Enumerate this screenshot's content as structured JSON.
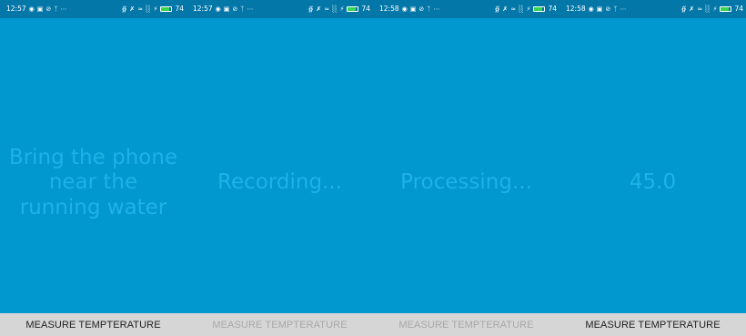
{
  "colors": {
    "status_bar": "#0277a8",
    "content_background": "#0197cf",
    "main_text": "#1fb2e6",
    "button_background": "#d6d6d6",
    "button_text_enabled": "#1e1e1e",
    "button_text_disabled": "#a8a8a8",
    "battery_fill": "#39d353"
  },
  "screens": [
    {
      "status": {
        "time": "12:57",
        "left_icons": [
          "chat-icon",
          "image-icon",
          "circle-check-icon",
          "usb-icon",
          "ellipsis-icon"
        ],
        "right_icons": [
          "bluetooth-icon",
          "vibrate-icon",
          "wifi-icon",
          "signal-icon",
          "charging-icon"
        ],
        "battery_level": "74"
      },
      "main_text": "Bring the phone near the running water",
      "button": {
        "label": "MEASURE TEMPTERATURE",
        "enabled": true
      }
    },
    {
      "status": {
        "time": "12:57",
        "left_icons": [
          "chat-icon",
          "image-icon",
          "circle-check-icon",
          "usb-icon",
          "ellipsis-icon"
        ],
        "right_icons": [
          "bluetooth-icon",
          "vibrate-icon",
          "wifi-icon",
          "signal-icon",
          "charging-icon"
        ],
        "battery_level": "74"
      },
      "main_text": "Recording...",
      "button": {
        "label": "MEASURE TEMPTERATURE",
        "enabled": false
      }
    },
    {
      "status": {
        "time": "12:58",
        "left_icons": [
          "chat-icon",
          "image-icon",
          "circle-check-icon",
          "usb-icon",
          "ellipsis-icon"
        ],
        "right_icons": [
          "bluetooth-icon",
          "vibrate-icon",
          "wifi-icon",
          "signal-icon",
          "charging-icon"
        ],
        "battery_level": "74"
      },
      "main_text": "Processing...",
      "button": {
        "label": "MEASURE TEMPTERATURE",
        "enabled": false
      }
    },
    {
      "status": {
        "time": "12:58",
        "left_icons": [
          "chat-icon",
          "image-icon",
          "circle-check-icon",
          "usb-icon",
          "ellipsis-icon"
        ],
        "right_icons": [
          "bluetooth-icon",
          "vibrate-icon",
          "wifi-icon",
          "signal-icon",
          "charging-icon"
        ],
        "battery_level": "74"
      },
      "main_text": "45.0",
      "button": {
        "label": "MEASURE TEMPTERATURE",
        "enabled": true
      }
    }
  ]
}
